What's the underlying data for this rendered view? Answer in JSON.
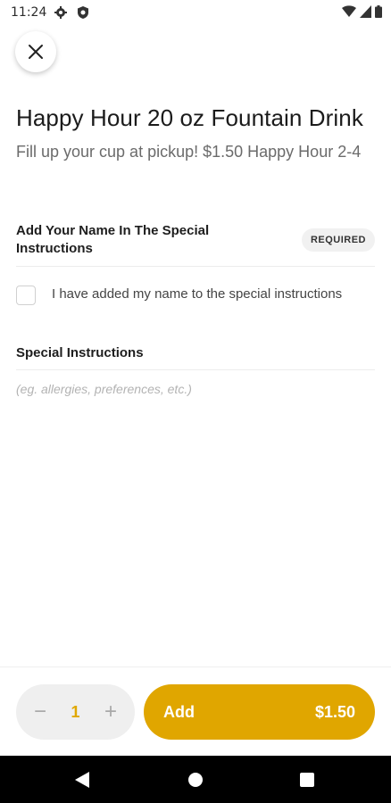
{
  "status_bar": {
    "time": "11:24",
    "icons": [
      "settings-icon",
      "shield-icon",
      "wifi-icon",
      "signal-icon",
      "battery-icon"
    ]
  },
  "close_icon": "close-icon",
  "item": {
    "title": "Happy Hour 20 oz Fountain Drink",
    "description": "Fill up your cup at pickup! $1.50 Happy Hour 2-4"
  },
  "option_group": {
    "title": "Add Your Name In The Special Instructions",
    "badge": "REQUIRED",
    "option_label": "I have added my name to the special instructions",
    "checked": false
  },
  "special_instructions": {
    "title": "Special Instructions",
    "placeholder": "(eg. allergies, preferences, etc.)",
    "value": ""
  },
  "order": {
    "decrement_label": "−",
    "quantity": "1",
    "increment_label": "+",
    "add_label": "Add",
    "price": "$1.50",
    "accent_color": "#e0a600"
  },
  "nav": {
    "icons": [
      "back-icon",
      "home-icon",
      "recents-icon"
    ]
  }
}
